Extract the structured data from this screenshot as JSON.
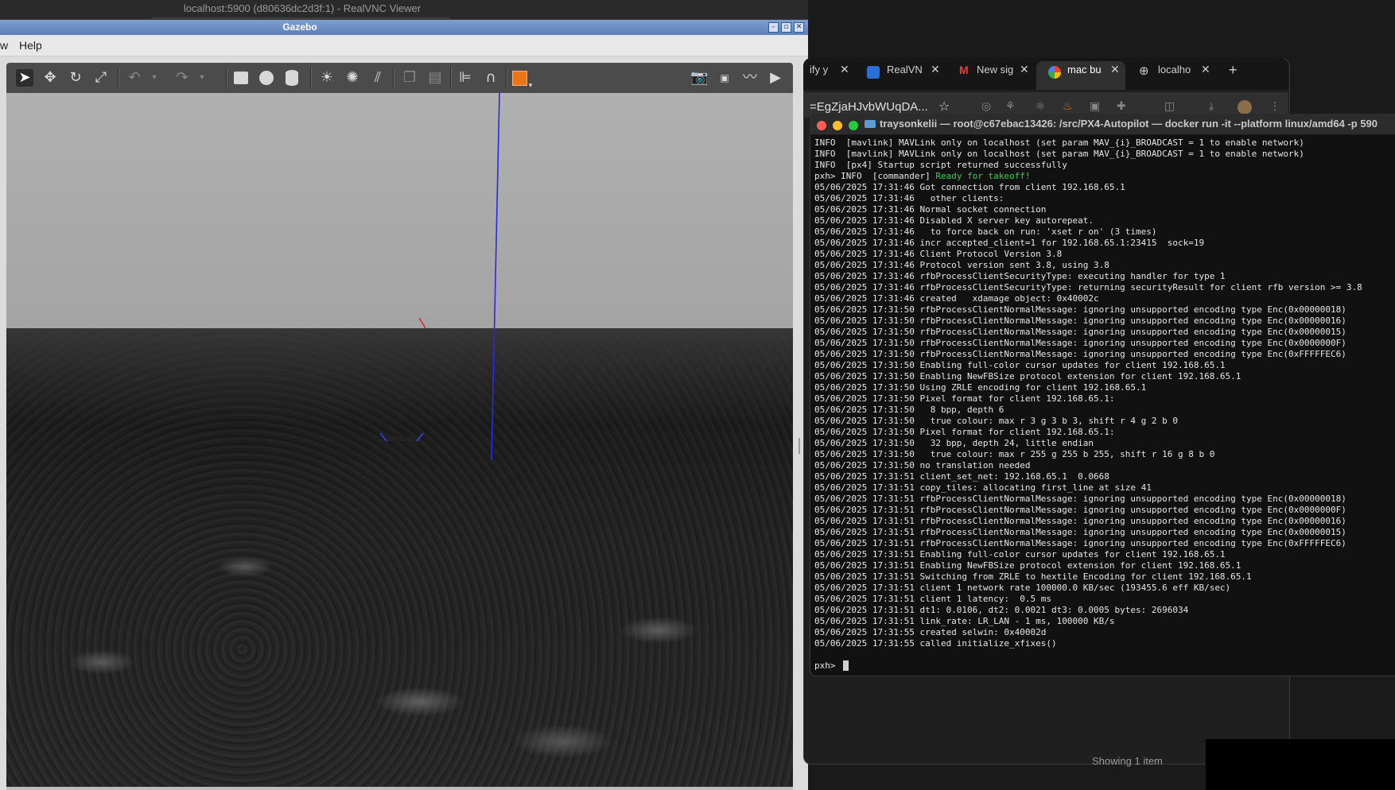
{
  "vnc": {
    "title": "localhost:5900 (d80636dc2d3f:1) - RealVNC Viewer"
  },
  "gazebo": {
    "title": "Gazebo",
    "menu": [
      "w",
      "Help"
    ],
    "toolbar_icons": [
      "select-arrow-icon",
      "translate-icon",
      "rotate-icon",
      "scale-icon",
      "undo-icon",
      "undo-dropdown-icon",
      "redo-icon",
      "redo-dropdown-icon",
      "box-icon",
      "sphere-icon",
      "cylinder-icon",
      "point-light-icon",
      "spot-light-icon",
      "directional-light-icon",
      "copy-icon",
      "paste-icon",
      "align-icon",
      "snap-icon",
      "view-angle-icon",
      "screenshot-icon",
      "log-icon",
      "plot-icon",
      "record-icon"
    ]
  },
  "browser": {
    "tabs": [
      {
        "label": "ify y",
        "icon": "none"
      },
      {
        "label": "RealVN",
        "icon": "realvnc-icon"
      },
      {
        "label": "New sig",
        "icon": "gmail-icon"
      },
      {
        "label": "mac bu",
        "icon": "google-icon"
      },
      {
        "label": "localho",
        "icon": "globe-icon"
      }
    ],
    "new_tab": "+",
    "address": "=EgZjaHJvbWUqDA...",
    "footer": "Showing 1 item"
  },
  "terminal": {
    "title": "traysonkelii — root@c67ebac13426: /src/PX4-Autopilot — docker run -it --platform linux/amd64 -p 590",
    "lines": [
      "INFO  [mavlink] MAVLink only on localhost (set param MAV_{i}_BROADCAST = 1 to enable network)",
      "INFO  [mavlink] MAVLink only on localhost (set param MAV_{i}_BROADCAST = 1 to enable network)",
      "INFO  [px4] Startup script returned successfully",
      "05/06/2025 17:31:46 Got connection from client 192.168.65.1",
      "05/06/2025 17:31:46   other clients:",
      "05/06/2025 17:31:46 Normal socket connection",
      "05/06/2025 17:31:46 Disabled X server key autorepeat.",
      "05/06/2025 17:31:46   to force back on run: 'xset r on' (3 times)",
      "05/06/2025 17:31:46 incr accepted_client=1 for 192.168.65.1:23415  sock=19",
      "05/06/2025 17:31:46 Client Protocol Version 3.8",
      "05/06/2025 17:31:46 Protocol version sent 3.8, using 3.8",
      "05/06/2025 17:31:46 rfbProcessClientSecurityType: executing handler for type 1",
      "05/06/2025 17:31:46 rfbProcessClientSecurityType: returning securityResult for client rfb version >= 3.8",
      "05/06/2025 17:31:46 created   xdamage object: 0x40002c",
      "05/06/2025 17:31:50 rfbProcessClientNormalMessage: ignoring unsupported encoding type Enc(0x00000018)",
      "05/06/2025 17:31:50 rfbProcessClientNormalMessage: ignoring unsupported encoding type Enc(0x00000016)",
      "05/06/2025 17:31:50 rfbProcessClientNormalMessage: ignoring unsupported encoding type Enc(0x00000015)",
      "05/06/2025 17:31:50 rfbProcessClientNormalMessage: ignoring unsupported encoding type Enc(0x0000000F)",
      "05/06/2025 17:31:50 rfbProcessClientNormalMessage: ignoring unsupported encoding type Enc(0xFFFFFEC6)",
      "05/06/2025 17:31:50 Enabling full-color cursor updates for client 192.168.65.1",
      "05/06/2025 17:31:50 Enabling NewFBSize protocol extension for client 192.168.65.1",
      "05/06/2025 17:31:50 Using ZRLE encoding for client 192.168.65.1",
      "05/06/2025 17:31:50 Pixel format for client 192.168.65.1:",
      "05/06/2025 17:31:50   8 bpp, depth 6",
      "05/06/2025 17:31:50   true colour: max r 3 g 3 b 3, shift r 4 g 2 b 0",
      "05/06/2025 17:31:50 Pixel format for client 192.168.65.1:",
      "05/06/2025 17:31:50   32 bpp, depth 24, little endian",
      "05/06/2025 17:31:50   true colour: max r 255 g 255 b 255, shift r 16 g 8 b 0",
      "05/06/2025 17:31:50 no translation needed",
      "05/06/2025 17:31:51 client_set_net: 192.168.65.1  0.0668",
      "05/06/2025 17:31:51 copy_tiles: allocating first_line at size 41",
      "05/06/2025 17:31:51 rfbProcessClientNormalMessage: ignoring unsupported encoding type Enc(0x00000018)",
      "05/06/2025 17:31:51 rfbProcessClientNormalMessage: ignoring unsupported encoding type Enc(0x0000000F)",
      "05/06/2025 17:31:51 rfbProcessClientNormalMessage: ignoring unsupported encoding type Enc(0x00000016)",
      "05/06/2025 17:31:51 rfbProcessClientNormalMessage: ignoring unsupported encoding type Enc(0x00000015)",
      "05/06/2025 17:31:51 rfbProcessClientNormalMessage: ignoring unsupported encoding type Enc(0xFFFFFEC6)",
      "05/06/2025 17:31:51 Enabling full-color cursor updates for client 192.168.65.1",
      "05/06/2025 17:31:51 Enabling NewFBSize protocol extension for client 192.168.65.1",
      "05/06/2025 17:31:51 Switching from ZRLE to hextile Encoding for client 192.168.65.1",
      "05/06/2025 17:31:51 client 1 network rate 100000.0 KB/sec (193455.6 eff KB/sec)",
      "05/06/2025 17:31:51 client 1 latency:  0.5 ms",
      "05/06/2025 17:31:51 dt1: 0.0106, dt2: 0.0021 dt3: 0.0005 bytes: 2696034",
      "05/06/2025 17:31:51 link_rate: LR_LAN - 1 ms, 100000 KB/s",
      "05/06/2025 17:31:55 created selwin: 0x40002d",
      "05/06/2025 17:31:55 called initialize_xfixes()"
    ],
    "commander_prefix": "pxh> INFO  [commander] ",
    "commander_msg": "Ready for takeoff!",
    "prompt": "pxh> "
  },
  "colors": {
    "terminal_green": "#38d04e",
    "gazebo_title_blue": "#6f90c7"
  }
}
